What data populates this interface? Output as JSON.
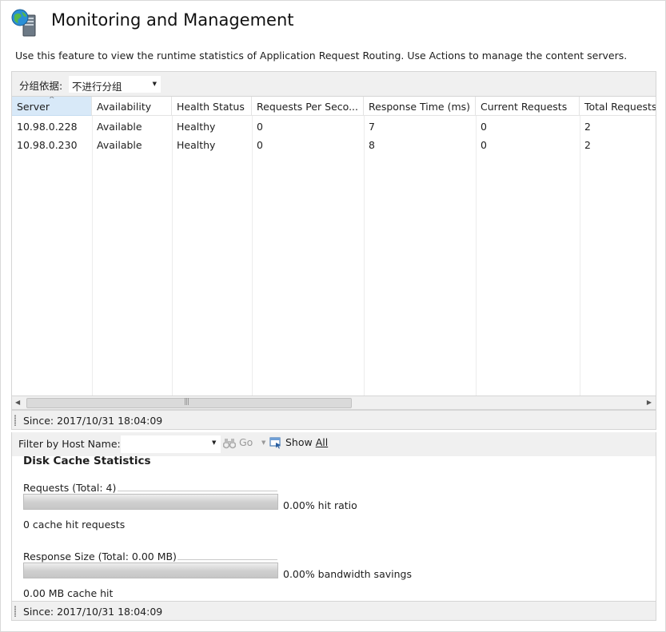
{
  "header": {
    "icon": "globe-server-icon",
    "title": "Monitoring and Management",
    "description": "Use this feature to view the runtime statistics of Application Request Routing. Use Actions to manage the content servers."
  },
  "group_by": {
    "label": "分组依据:",
    "selected": "不进行分组"
  },
  "grid": {
    "columns": [
      "Server",
      "Availability",
      "Health Status",
      "Requests Per Seco...",
      "Response Time (ms)",
      "Current Requests",
      "Total Requests"
    ],
    "sorted_column": "Server",
    "rows": [
      [
        "10.98.0.228",
        "Available",
        "Healthy",
        "0",
        "7",
        "0",
        "2"
      ],
      [
        "10.98.0.230",
        "Available",
        "Healthy",
        "0",
        "8",
        "0",
        "2"
      ]
    ]
  },
  "grid_status": "Since: 2017/10/31 18:04:09",
  "filter": {
    "label": "Filter by Host Name:",
    "value": "",
    "go_label": "Go",
    "show_all_prefix": "Show ",
    "show_all_accel": "All"
  },
  "disk_cache": {
    "title": "Disk Cache Statistics",
    "requests_label": "Requests (Total: 4)",
    "hit_ratio_text": "0.00% hit ratio",
    "hit_ratio": 0.0,
    "cache_hits_text": "0 cache hit requests",
    "response_size_label": "Response Size (Total: 0.00 MB)",
    "bandwidth_text": "0.00% bandwidth savings",
    "bandwidth_savings": 0.0,
    "cache_hit_size_text": "0.00 MB cache hit"
  },
  "bottom_status": "Since: 2017/10/31 18:04:09"
}
